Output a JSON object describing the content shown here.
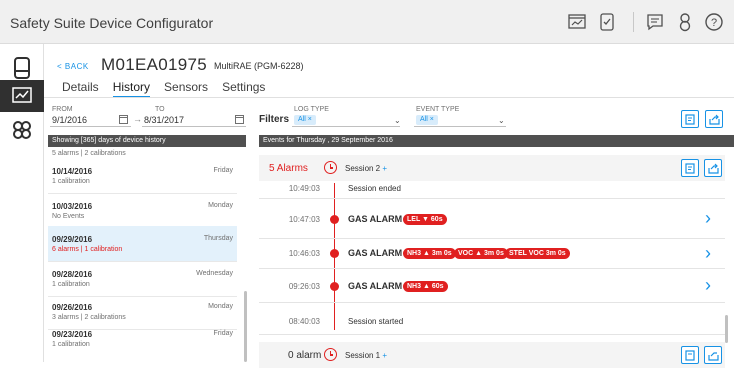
{
  "app": {
    "title": "Safety Suite Device Configurator"
  },
  "top_icons": [
    "monitor-icon",
    "device-check-icon",
    "chat-icon",
    "user-icon",
    "help-icon"
  ],
  "rail": [
    "device-icon",
    "chart-icon",
    "users-icon"
  ],
  "device": {
    "back_label": "< BACK",
    "id": "M01EA01975",
    "model": "MultiRAE (PGM-6228)"
  },
  "tabs": [
    "Details",
    "History",
    "Sensors",
    "Settings"
  ],
  "active_tab": "History",
  "date_filter": {
    "from_label": "FROM",
    "from_value": "9/1/2016",
    "to_label": "TO",
    "to_value": "8/31/2017",
    "arrow": "→"
  },
  "filters": {
    "label": "Filters",
    "log_type": {
      "label": "LOG TYPE",
      "chip": "All ×"
    },
    "event_type": {
      "label": "EVENT TYPE",
      "chip": "All ×"
    }
  },
  "days_header": "Showing [365] days of device history",
  "days_cut": "5 alarms  |  2 calibrations",
  "days": [
    {
      "date": "10/14/2016",
      "day": "Friday",
      "sub": "1 calibration",
      "alarm": false,
      "selected": false
    },
    {
      "date": "10/03/2016",
      "day": "Monday",
      "sub": "No Events",
      "alarm": false,
      "selected": false
    },
    {
      "date": "09/29/2016",
      "day": "Thursday",
      "sub": "6 alarms  |  1 calibration",
      "alarm": true,
      "selected": true
    },
    {
      "date": "09/28/2016",
      "day": "Wednesday",
      "sub": "1 calibration",
      "alarm": false,
      "selected": false
    },
    {
      "date": "09/26/2016",
      "day": "Monday",
      "sub": "3 alarms  |  2 calibrations",
      "alarm": false,
      "selected": false
    },
    {
      "date": "09/23/2016",
      "day": "Friday",
      "sub": "1 calibration",
      "alarm": false,
      "selected": false
    }
  ],
  "events_header": "Events for Thursday , 29 September 2016",
  "session2": {
    "alarms": "5 Alarms",
    "label": "Session 2",
    "plus": "+"
  },
  "events": [
    {
      "time": "10:49:03",
      "type": "text",
      "text": "Session ended",
      "badges": []
    },
    {
      "time": "10:47:03",
      "type": "alarm",
      "text": "GAS ALARM",
      "badges": [
        "LEL ▼ 60s"
      ]
    },
    {
      "time": "10:46:03",
      "type": "alarm",
      "text": "GAS ALARM",
      "badges": [
        "NH3 ▲ 3m 0s",
        "VOC ▲ 3m 0s",
        "STEL VOC 3m 0s"
      ]
    },
    {
      "time": "09:26:03",
      "type": "alarm",
      "text": "GAS ALARM",
      "badges": [
        "NH3 ▲ 60s"
      ]
    },
    {
      "time": "08:40:03",
      "type": "text",
      "text": "Session started",
      "badges": []
    }
  ],
  "session1": {
    "alarms": "0 alarm",
    "label": "Session 1",
    "plus": "+"
  },
  "colors": {
    "accent": "#1792e5",
    "alarm": "#e02020",
    "header_dark": "#505050"
  }
}
